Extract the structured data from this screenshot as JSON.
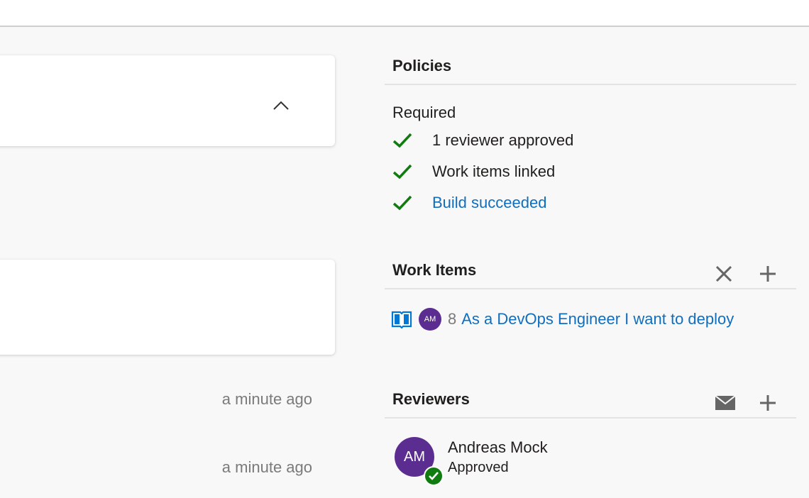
{
  "left": {
    "timestamps": [
      "a minute ago",
      "a minute ago"
    ]
  },
  "policies": {
    "title": "Policies",
    "required_label": "Required",
    "items": [
      {
        "label": "1 reviewer approved",
        "status": "passed",
        "is_link": false
      },
      {
        "label": "Work items linked",
        "status": "passed",
        "is_link": false
      },
      {
        "label": "Build succeeded",
        "status": "passed",
        "is_link": true
      }
    ]
  },
  "work_items": {
    "title": "Work Items",
    "items": [
      {
        "icon": "book-icon",
        "assignee_initials": "AM",
        "id": "8",
        "title": "As a DevOps Engineer I want to deploy"
      }
    ]
  },
  "reviewers": {
    "title": "Reviewers",
    "items": [
      {
        "initials": "AM",
        "name": "Andreas Mock",
        "vote": "Approved"
      }
    ]
  },
  "colors": {
    "success": "#107c10",
    "link": "#106ebe",
    "avatar": "#5c2d91",
    "book_icon": "#0078d4"
  }
}
